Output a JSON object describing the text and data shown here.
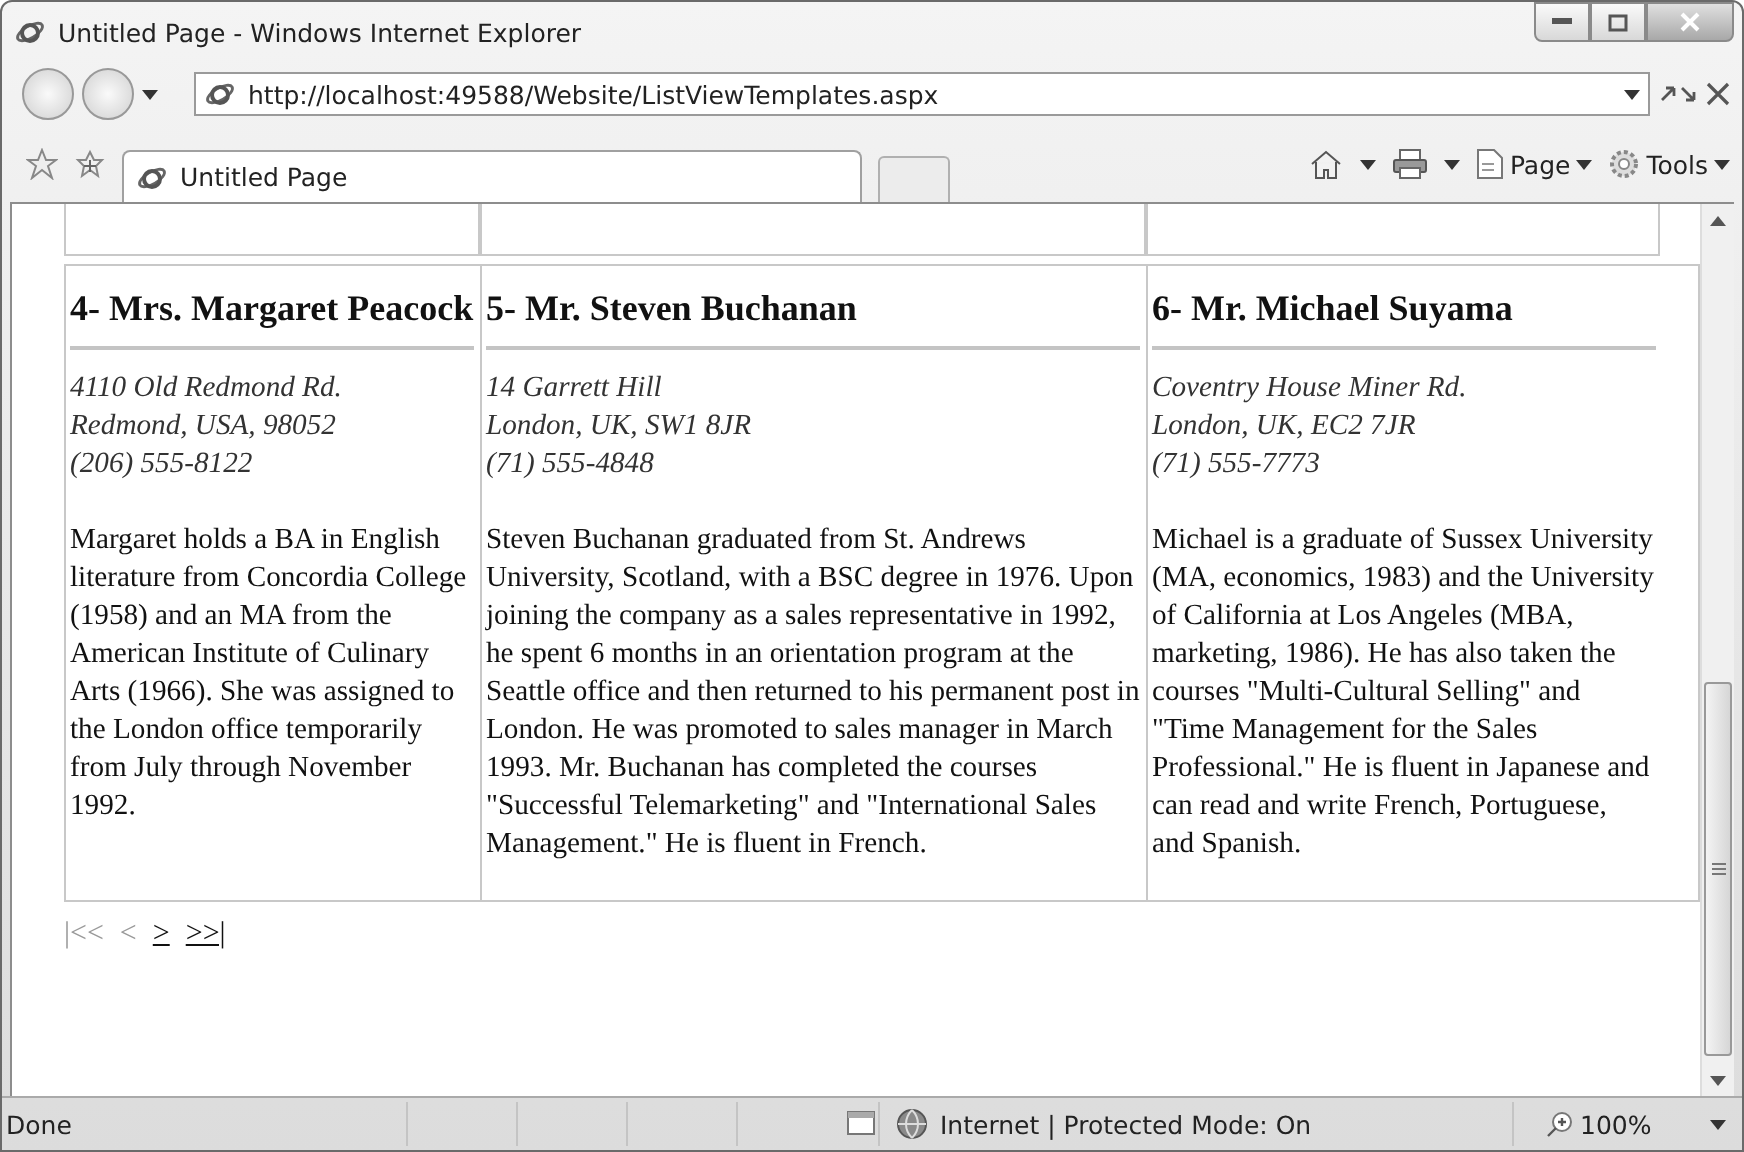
{
  "window": {
    "title": "Untitled Page - Windows Internet Explorer"
  },
  "address_bar": {
    "value": "http://localhost:49588/Website/ListViewTemplates.aspx"
  },
  "tabs": [
    {
      "label": "Untitled Page",
      "selected": true
    }
  ],
  "command_bar": {
    "items": [
      "Page",
      "Tools"
    ]
  },
  "employees": [
    {
      "heading": "4- Mrs. Margaret Peacock",
      "address_lines": [
        "4110 Old Redmond Rd.",
        "Redmond, USA, 98052",
        "(206) 555-8122"
      ],
      "bio": "Margaret holds a BA in English literature from Concordia College (1958) and an MA from the American Institute of Culinary Arts (1966). She was assigned to the London office temporarily from July through November 1992."
    },
    {
      "heading": "5- Mr. Steven Buchanan",
      "address_lines": [
        "14 Garrett Hill",
        "London, UK, SW1 8JR",
        "(71) 555-4848"
      ],
      "bio": "Steven Buchanan graduated from St. Andrews University, Scotland, with a BSC degree in 1976. Upon joining the company as a sales representative in 1992, he spent 6 months in an orientation program at the Seattle office and then returned to his permanent post in London. He was promoted to sales manager in March 1993. Mr. Buchanan has completed the courses \"Successful Telemarketing\" and \"International Sales Management.\" He is fluent in French."
    },
    {
      "heading": "6- Mr. Michael Suyama",
      "address_lines": [
        "Coventry House Miner Rd.",
        "London, UK, EC2 7JR",
        "(71) 555-7773"
      ],
      "bio": "Michael is a graduate of Sussex University (MA, economics, 1983) and the University of California at Los Angeles (MBA, marketing, 1986). He has also taken the courses \"Multi-Cultural Selling\" and \"Time Management for the Sales Professional.\" He is fluent in Japanese and can read and write French, Portuguese, and Spanish."
    }
  ],
  "pager": [
    {
      "label": "|<<",
      "disabled": true
    },
    {
      "label": "<",
      "disabled": true
    },
    {
      "label": ">",
      "disabled": false
    },
    {
      "label": ">>|",
      "disabled": false
    }
  ],
  "status_bar": {
    "text": "Done",
    "zone": "Internet | Protected Mode: On",
    "zoom": "100%"
  }
}
